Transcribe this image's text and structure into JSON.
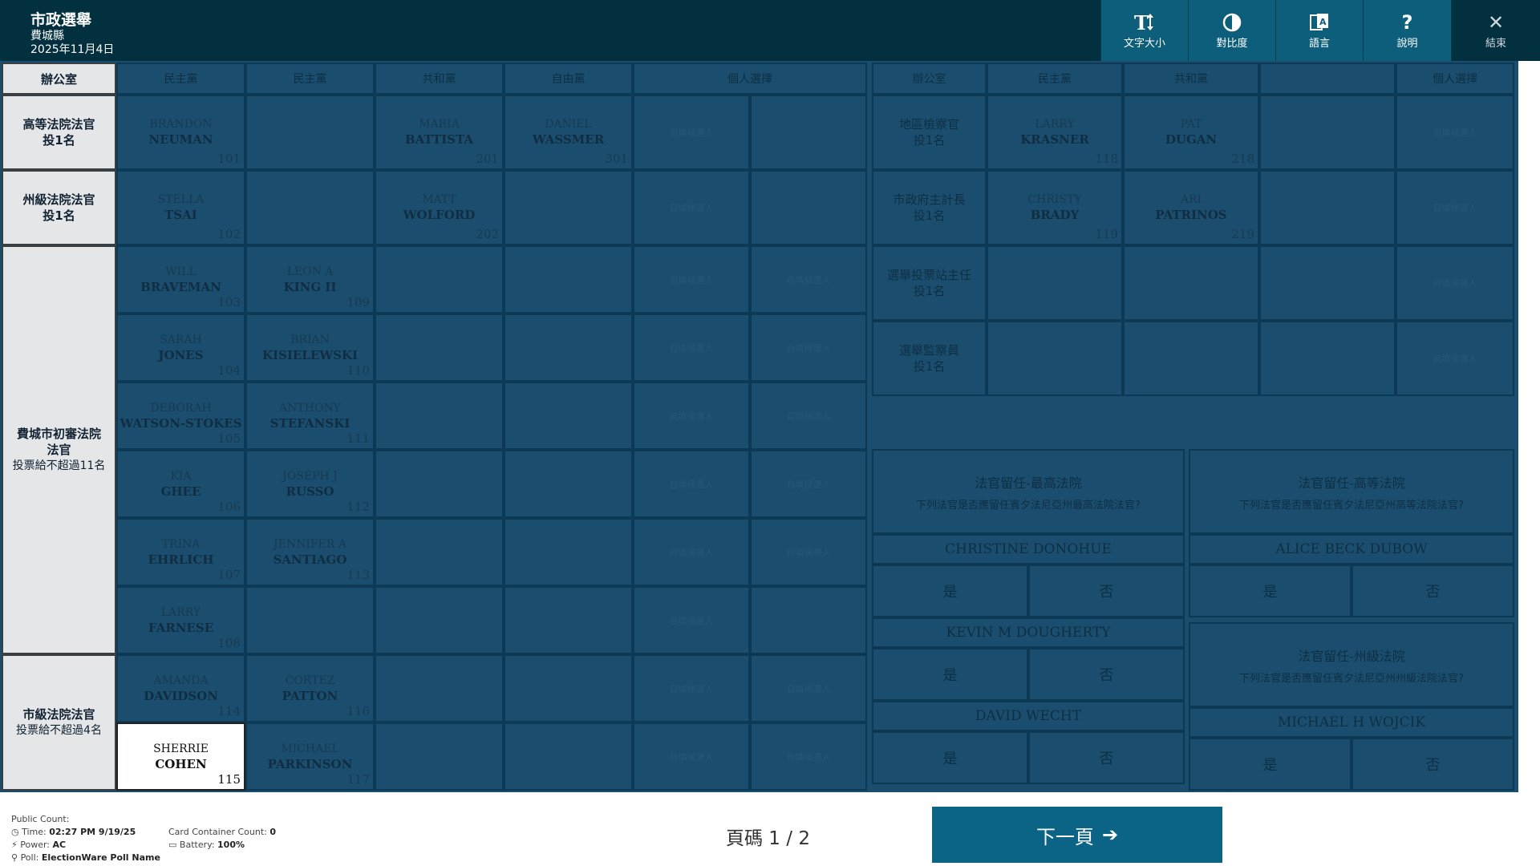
{
  "header": {
    "title": "市政選舉",
    "county": "費城縣",
    "date": "2025年11月4日"
  },
  "toolbar": {
    "text_size": "文字大小",
    "contrast": "對比度",
    "language": "語言",
    "help": "說明",
    "exit": "結束"
  },
  "left_table": {
    "office_header": "辦公室",
    "party_headers": [
      "民主黨",
      "民主黨",
      "共和黨",
      "自由黨",
      "個人選擇"
    ],
    "writein": "自填候選人",
    "offices": [
      {
        "name": "高等法院法官",
        "instr": "投1名"
      },
      {
        "name": "州級法院法官",
        "instr": "投1名"
      },
      {
        "name": "費城市初審法院\n法官",
        "instr": "投票給不超過11名"
      },
      {
        "name": "市級法院法官",
        "instr": "投票給不超過4名"
      }
    ],
    "candidates": {
      "c101": {
        "first": "BRANDON",
        "last": "NEUMAN",
        "num": "101"
      },
      "c201": {
        "first": "MARIA",
        "last": "BATTISTA",
        "num": "201"
      },
      "c301": {
        "first": "DANIEL",
        "last": "WASSMER",
        "num": "301"
      },
      "c102": {
        "first": "STELLA",
        "last": "TSAI",
        "num": "102"
      },
      "c202": {
        "first": "MATT",
        "last": "WOLFORD",
        "num": "202"
      },
      "c103": {
        "first": "WILL",
        "last": "BRAVEMAN",
        "num": "103"
      },
      "c109": {
        "first": "LEON A",
        "last": "KING II",
        "num": "109"
      },
      "c104": {
        "first": "SARAH",
        "last": "JONES",
        "num": "104"
      },
      "c110": {
        "first": "BRIAN",
        "last": "KISIELEWSKI",
        "num": "110"
      },
      "c105": {
        "first": "DEBORAH",
        "last": "WATSON-STOKES",
        "num": "105"
      },
      "c111": {
        "first": "ANTHONY",
        "last": "STEFANSKI",
        "num": "111"
      },
      "c106": {
        "first": "KIA",
        "last": "GHEE",
        "num": "106"
      },
      "c112": {
        "first": "JOSEPH J",
        "last": "RUSSO",
        "num": "112"
      },
      "c107": {
        "first": "TRINA",
        "last": "EHRLICH",
        "num": "107"
      },
      "c113": {
        "first": "JENNIFER A",
        "last": "SANTIAGO",
        "num": "113"
      },
      "c108": {
        "first": "LARRY",
        "last": "FARNESE",
        "num": "108"
      },
      "c114": {
        "first": "AMANDA",
        "last": "DAVIDSON",
        "num": "114"
      },
      "c116": {
        "first": "CORTEZ",
        "last": "PATTON",
        "num": "116"
      },
      "c115": {
        "first": "SHERRIE",
        "last": "COHEN",
        "num": "115"
      },
      "c117": {
        "first": "MICHAEL",
        "last": "PARKINSON",
        "num": "117"
      }
    }
  },
  "right_table": {
    "office_header": "辦公室",
    "party_headers": [
      "民主黨",
      "共和黨",
      "",
      "個人選擇"
    ],
    "offices": [
      {
        "name": "地區檢察官",
        "instr": "投1名"
      },
      {
        "name": "市政府主計長",
        "instr": "投1名"
      },
      {
        "name": "選舉投票站主任",
        "instr": "投1名"
      },
      {
        "name": "選舉監察員",
        "instr": "投1名"
      }
    ],
    "candidates": {
      "c118": {
        "first": "LARRY",
        "last": "KRASNER",
        "num": "118"
      },
      "c218": {
        "first": "PAT",
        "last": "DUGAN",
        "num": "218"
      },
      "c119": {
        "first": "CHRISTY",
        "last": "BRADY",
        "num": "119"
      },
      "c219": {
        "first": "ARI",
        "last": "PATRINOS",
        "num": "219"
      }
    }
  },
  "retention": {
    "yes": "是",
    "no": "否",
    "supreme": {
      "title": "法官留任-最高法院",
      "desc": "下列法官是否應留任賓夕法尼亞州最高法院法官?",
      "judges": [
        "CHRISTINE DONOHUE",
        "KEVIN M DOUGHERTY",
        "DAVID WECHT"
      ]
    },
    "superior": {
      "title": "法官留任-高等法院",
      "desc": "下列法官是否應留任賓夕法尼亞州高等法院法官?",
      "judges": [
        "ALICE BECK DUBOW"
      ]
    },
    "commonwealth": {
      "title": "法官留任-州級法院",
      "desc": "下列法官是否應留任賓夕法尼亞州州級法院法官?",
      "judges": [
        "MICHAEL H WOJCIK"
      ]
    }
  },
  "footer": {
    "public_count": "Public Count:",
    "time_label": "Time:",
    "time_value": "02:27 PM 9/19/25",
    "power_label": "Power:",
    "power_value": "AC",
    "poll_label": "Poll:",
    "poll_value": "ElectionWare Poll Name",
    "card_label": "Card Container Count:",
    "card_value": "0",
    "battery_label": "Battery:",
    "battery_value": "100%",
    "page_indicator": "頁碼 1 / 2",
    "next_label": "下一頁"
  },
  "colors": {
    "header_bg": "#02303f",
    "toolbar_bg": "#0c5e7a",
    "ballot_bg": "#1b4e6e",
    "office_bg": "#e4e6e8",
    "next_bg": "#0b6385"
  }
}
